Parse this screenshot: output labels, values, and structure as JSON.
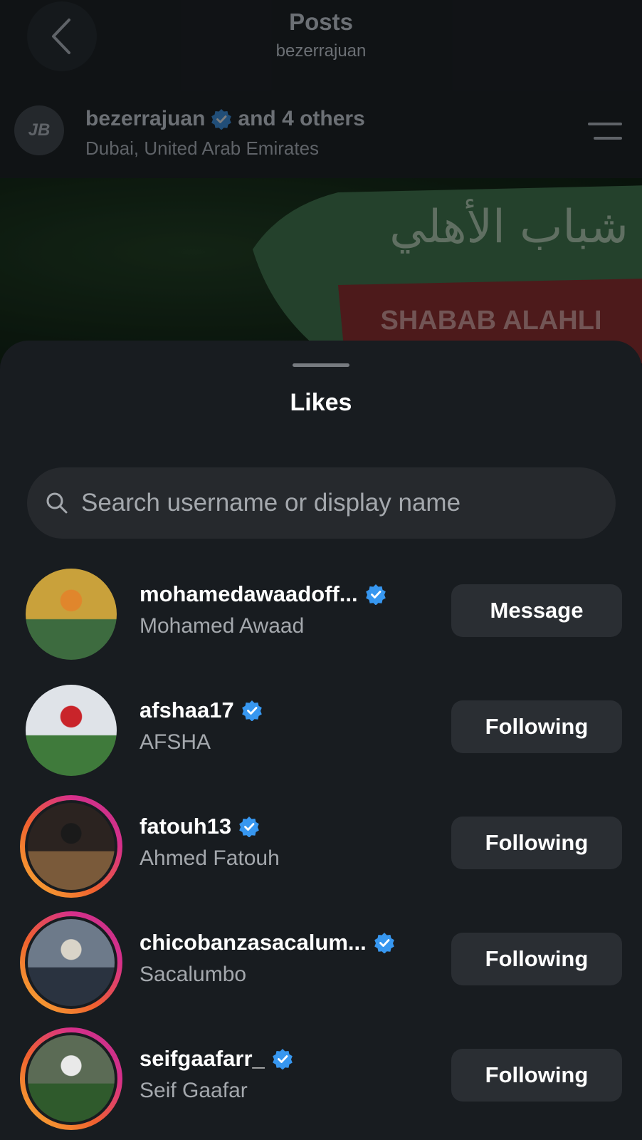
{
  "header": {
    "title": "Posts",
    "subtitle": "bezerrajuan",
    "back_icon": "chevron-left-icon"
  },
  "post": {
    "username": "bezerrajuan",
    "collab_text": "and 4 others",
    "location": "Dubai, United Arab Emirates",
    "avatar_text": "JB",
    "menu_icon": "menu-icon",
    "image_text_arabic": "شباب الأهلي",
    "image_text_latin": "SHABAB ALAHLI"
  },
  "sheet": {
    "title": "Likes",
    "search_placeholder": "Search username or display name",
    "users": [
      {
        "username": "mohamedawaadoff...",
        "display_name": "Mohamed Awaad",
        "button": "Message",
        "ring": false,
        "colors": [
          "#c9a13b",
          "#3d6b3f",
          "#e0862c"
        ]
      },
      {
        "username": "afshaa17",
        "display_name": "AFSHA",
        "button": "Following",
        "ring": false,
        "colors": [
          "#dfe3e8",
          "#3f7a3b",
          "#c9242a"
        ]
      },
      {
        "username": "fatouh13",
        "display_name": "Ahmed Fatouh",
        "button": "Following",
        "ring": true,
        "colors": [
          "#2b2320",
          "#7a5a3a",
          "#1a1a1a"
        ]
      },
      {
        "username": "chicobanzasacalum...",
        "display_name": "Sacalumbo",
        "button": "Following",
        "ring": true,
        "colors": [
          "#6d7a8a",
          "#2a3340",
          "#d9d4c8"
        ]
      },
      {
        "username": "seifgaafarr_",
        "display_name": "Seif Gaafar",
        "button": "Following",
        "ring": true,
        "colors": [
          "#5b6b55",
          "#2f5a2c",
          "#e9e9e9"
        ]
      }
    ]
  },
  "colors": {
    "accent_verified": "#3797f0",
    "sheet_bg": "#181c20",
    "button_bg": "#2a2e33"
  }
}
